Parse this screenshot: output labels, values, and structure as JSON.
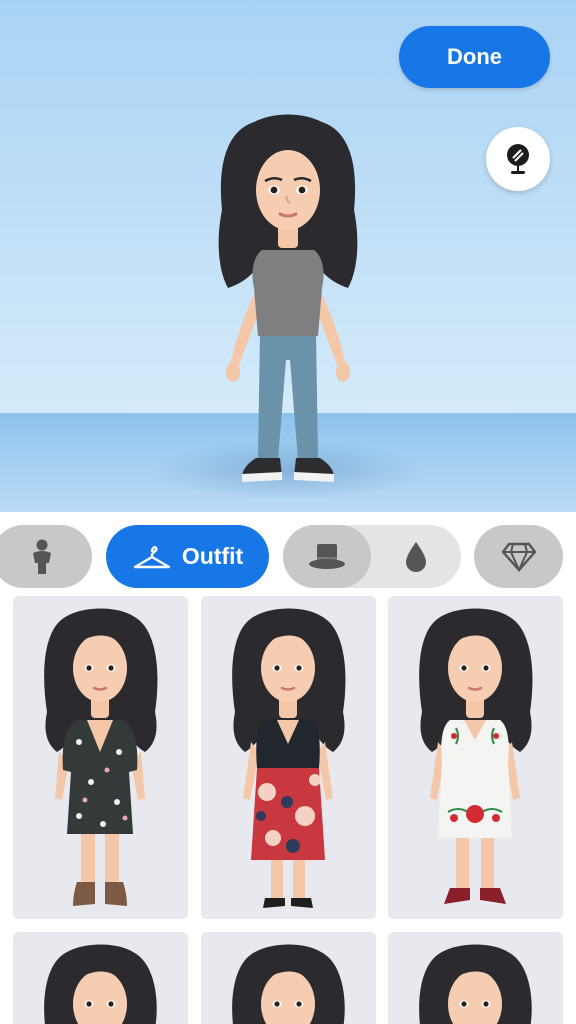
{
  "header": {
    "done_label": "Done"
  },
  "categories": [
    {
      "name": "body",
      "icon": "person-icon",
      "selected": false
    },
    {
      "name": "outfit",
      "label": "Outfit",
      "icon": "hanger-icon",
      "selected": true
    },
    {
      "name": "headwear",
      "icon": "top-hat-icon",
      "selected": false
    },
    {
      "name": "color",
      "icon": "drop-icon",
      "selected": false
    },
    {
      "name": "accessories",
      "icon": "diamond-icon",
      "selected": false
    }
  ],
  "colors": {
    "accent": "#1877e6",
    "stage_sky": "#c7e3f8",
    "floor": "#a6d0f2",
    "card_bg": "#e8e9ee",
    "pill_gray": "#c8c8ca"
  },
  "outfits": [
    {
      "id": "floral-dark-wrap-dress"
    },
    {
      "id": "black-top-floral-skirt"
    },
    {
      "id": "white-embroidered-dress"
    },
    {
      "id": "outfit-4"
    },
    {
      "id": "outfit-5"
    },
    {
      "id": "outfit-6"
    }
  ]
}
